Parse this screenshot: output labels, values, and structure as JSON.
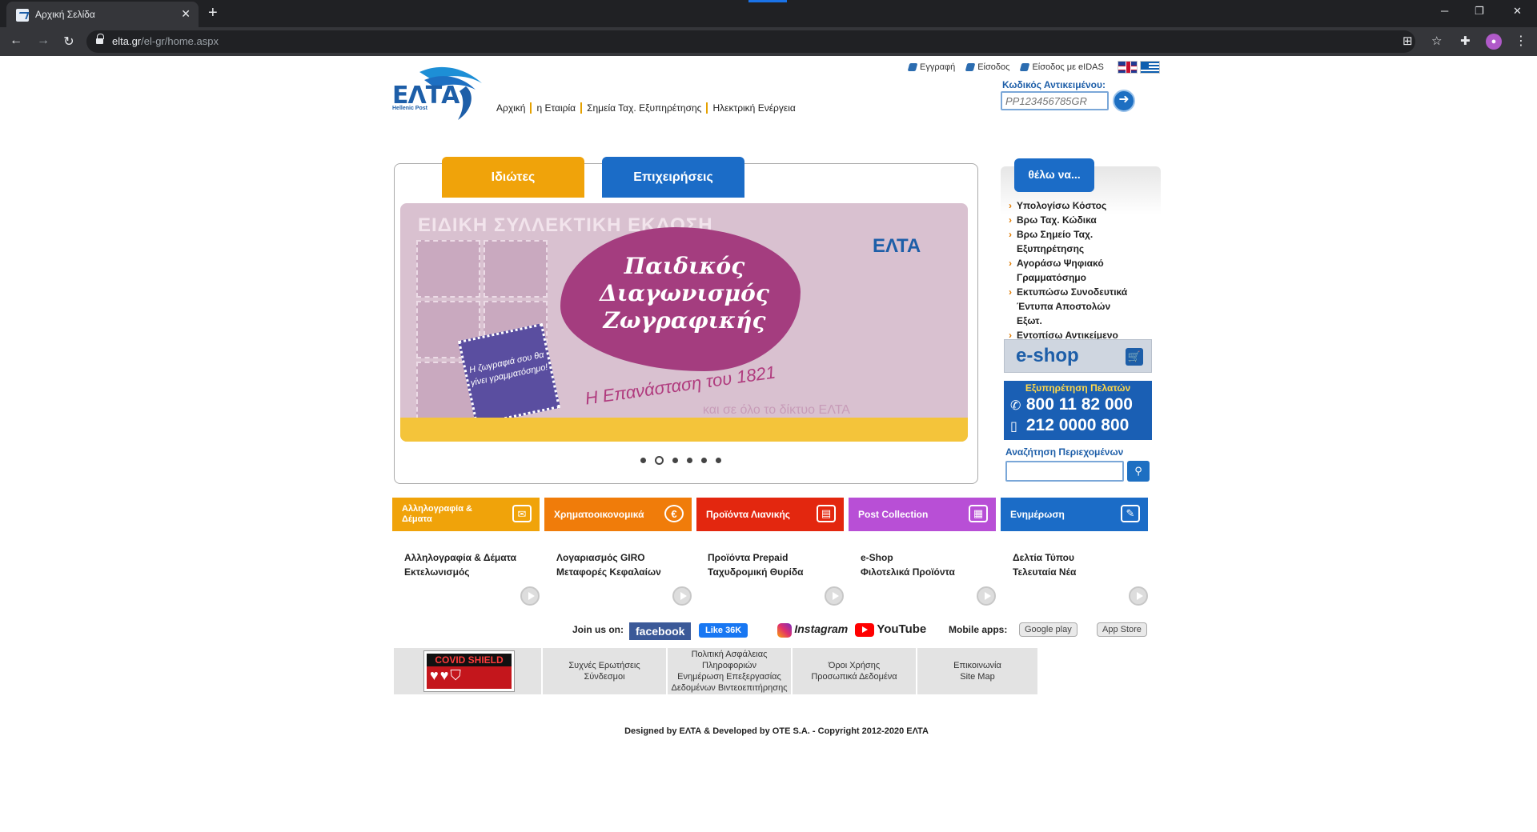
{
  "browser": {
    "tab_title": "Αρχική Σελίδα",
    "url_host": "elta.gr",
    "url_path": "/el-gr/home.aspx"
  },
  "header": {
    "register": "Εγγραφή",
    "login": "Είσοδος",
    "login_eidas": "Είσοδος με eIDAS",
    "logo_text": "ΕΛΤΑ",
    "logo_sub": "Hellenic Post"
  },
  "nav": [
    "Αρχική",
    "η Εταιρία",
    "Σημεία Ταχ. Εξυπηρέτησης",
    "Ηλεκτρική Ενέργεια"
  ],
  "tracking": {
    "label": "Κωδικός Αντικειμένου:",
    "placeholder": "PP123456785GR"
  },
  "tabs": {
    "private": "Ιδιώτες",
    "business": "Επιχειρήσεις"
  },
  "banner": {
    "headline": "ΕΙΔΙΚΗ ΣΥΛΛΕΚΤΙΚΗ ΕΚΔΟΣΗ",
    "title_line1": "Παιδικός",
    "title_line2": "Διαγωνισμός",
    "title_line3": "Ζωγραφικής",
    "subtitle": "Η Επανάσταση του 1821",
    "subtitle2": "και σε όλο το δίκτυο ΕΛΤΑ",
    "sticker": "Η ζωγραφιά σου θα γίνει γραμματόσημο!",
    "logo": "ΕΛΤΑ",
    "active_slide": 2,
    "slide_count": 6
  },
  "want": {
    "button": "θέλω να...",
    "items": [
      "Υπολογίσω Κόστος",
      "Βρω Ταχ. Κώδικα",
      "Βρω Σημείο Ταχ. Εξυπηρέτησης",
      "Αγοράσω Ψηφιακό Γραμματόσημο",
      "Εκτυπώσω Συνοδευτικά Έντυπα Αποστολών Εξωτ.",
      "Εντοπίσω Αντικείμενο"
    ]
  },
  "eshop": {
    "label": "e-shop"
  },
  "service": {
    "title": "Εξυπηρέτηση Πελατών",
    "phone1": "800 11 82 000",
    "phone2": "212 0000 800"
  },
  "search": {
    "label": "Αναζήτηση Περιεχομένων",
    "placeholder": ""
  },
  "categories": [
    {
      "label": "Αλληλογραφία & Δέματα",
      "color": "#f0a30a",
      "line1": "Αλληλογραφία & Δέματα",
      "line2": "Εκτελωνισμός"
    },
    {
      "label": "Χρηματοοικονομικά",
      "color": "#f07c0a",
      "line1": "Λογαριασμός GIRO",
      "line2": "Μεταφορές Κεφαλαίων"
    },
    {
      "label": "Προϊόντα Λιανικής",
      "color": "#e3270f",
      "line1": "Προϊόντα Prepaid",
      "line2": "Ταχυδρομική Θυρίδα"
    },
    {
      "label": "Post Collection",
      "color": "#b84fd6",
      "line1": "e-Shop",
      "line2": "Φιλοτελικά Προϊόντα"
    },
    {
      "label": "Ενημέρωση",
      "color": "#1b6cc7",
      "line1": "Δελτία Τύπου",
      "line2": "Τελευταία Νέα"
    }
  ],
  "social": {
    "join": "Join us on:",
    "facebook": "facebook",
    "like": "Like 36K",
    "instagram": "Instagram",
    "youtube": "YouTube",
    "mobile": "Mobile apps:",
    "google_play": "Google play",
    "app_store": "App Store"
  },
  "footer": {
    "covid": "COVID SHIELD",
    "col2": [
      "Συχνές Ερωτήσεις",
      "Σύνδεσμοι"
    ],
    "col3": [
      "Πολιτική Ασφάλειας Πληροφοριών",
      "Ενημέρωση Επεξεργασίας",
      "Δεδομένων Βιντεοεπιτήρησης"
    ],
    "col4": [
      "Όροι Χρήσης",
      "Προσωπικά Δεδομένα"
    ],
    "col5": [
      "Επικοινωνία",
      "Site Map"
    ],
    "copyright": "Designed by ΕΛΤΑ & Developed by OTE S.A. - Copyright 2012-2020 ΕΛΤΑ"
  }
}
